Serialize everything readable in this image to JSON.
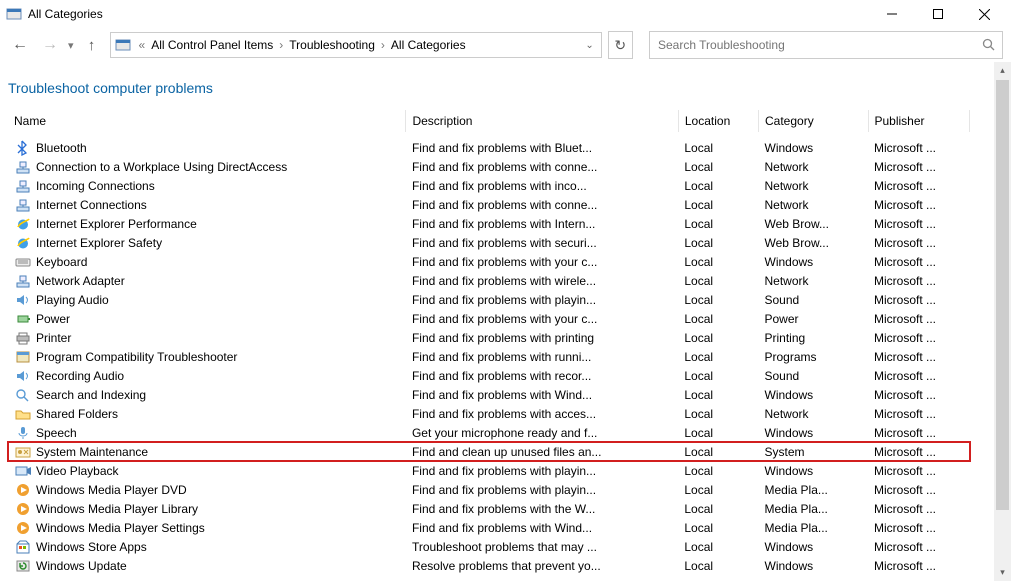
{
  "window": {
    "title": "All Categories"
  },
  "breadcrumb": {
    "icon_name": "control-panel-icon",
    "items": [
      "All Control Panel Items",
      "Troubleshooting",
      "All Categories"
    ]
  },
  "search": {
    "placeholder": "Search Troubleshooting"
  },
  "page": {
    "heading": "Troubleshoot computer problems"
  },
  "columns": {
    "name": "Name",
    "description": "Description",
    "location": "Location",
    "category": "Category",
    "publisher": "Publisher"
  },
  "rows": [
    {
      "icon": "bluetooth-icon",
      "name": "Bluetooth",
      "description": "Find and fix problems with Bluet...",
      "location": "Local",
      "category": "Windows",
      "publisher": "Microsoft ..."
    },
    {
      "icon": "network-icon",
      "name": "Connection to a Workplace Using DirectAccess",
      "description": "Find and fix problems with conne...",
      "location": "Local",
      "category": "Network",
      "publisher": "Microsoft ..."
    },
    {
      "icon": "network-icon",
      "name": "Incoming Connections",
      "description": "Find and fix problems with inco...",
      "location": "Local",
      "category": "Network",
      "publisher": "Microsoft ..."
    },
    {
      "icon": "network-icon",
      "name": "Internet Connections",
      "description": "Find and fix problems with conne...",
      "location": "Local",
      "category": "Network",
      "publisher": "Microsoft ..."
    },
    {
      "icon": "ie-icon",
      "name": "Internet Explorer Performance",
      "description": "Find and fix problems with Intern...",
      "location": "Local",
      "category": "Web Brow...",
      "publisher": "Microsoft ..."
    },
    {
      "icon": "ie-icon",
      "name": "Internet Explorer Safety",
      "description": "Find and fix problems with securi...",
      "location": "Local",
      "category": "Web Brow...",
      "publisher": "Microsoft ..."
    },
    {
      "icon": "keyboard-icon",
      "name": "Keyboard",
      "description": "Find and fix problems with your c...",
      "location": "Local",
      "category": "Windows",
      "publisher": "Microsoft ..."
    },
    {
      "icon": "network-icon",
      "name": "Network Adapter",
      "description": "Find and fix problems with wirele...",
      "location": "Local",
      "category": "Network",
      "publisher": "Microsoft ..."
    },
    {
      "icon": "sound-icon",
      "name": "Playing Audio",
      "description": "Find and fix problems with playin...",
      "location": "Local",
      "category": "Sound",
      "publisher": "Microsoft ..."
    },
    {
      "icon": "power-icon",
      "name": "Power",
      "description": "Find and fix problems with your c...",
      "location": "Local",
      "category": "Power",
      "publisher": "Microsoft ..."
    },
    {
      "icon": "printer-icon",
      "name": "Printer",
      "description": "Find and fix problems with printing",
      "location": "Local",
      "category": "Printing",
      "publisher": "Microsoft ..."
    },
    {
      "icon": "program-icon",
      "name": "Program Compatibility Troubleshooter",
      "description": "Find and fix problems with runni...",
      "location": "Local",
      "category": "Programs",
      "publisher": "Microsoft ..."
    },
    {
      "icon": "sound-icon",
      "name": "Recording Audio",
      "description": "Find and fix problems with recor...",
      "location": "Local",
      "category": "Sound",
      "publisher": "Microsoft ..."
    },
    {
      "icon": "search-icon",
      "name": "Search and Indexing",
      "description": "Find and fix problems with Wind...",
      "location": "Local",
      "category": "Windows",
      "publisher": "Microsoft ..."
    },
    {
      "icon": "folder-icon",
      "name": "Shared Folders",
      "description": "Find and fix problems with acces...",
      "location": "Local",
      "category": "Network",
      "publisher": "Microsoft ..."
    },
    {
      "icon": "mic-icon",
      "name": "Speech",
      "description": "Get your microphone ready and f...",
      "location": "Local",
      "category": "Windows",
      "publisher": "Microsoft ..."
    },
    {
      "icon": "maint-icon",
      "name": "System Maintenance",
      "description": "Find and clean up unused files an...",
      "location": "Local",
      "category": "System",
      "publisher": "Microsoft ...",
      "highlight": true
    },
    {
      "icon": "video-icon",
      "name": "Video Playback",
      "description": "Find and fix problems with playin...",
      "location": "Local",
      "category": "Windows",
      "publisher": "Microsoft ..."
    },
    {
      "icon": "wmp-icon",
      "name": "Windows Media Player DVD",
      "description": "Find and fix problems with playin...",
      "location": "Local",
      "category": "Media Pla...",
      "publisher": "Microsoft ..."
    },
    {
      "icon": "wmp-icon",
      "name": "Windows Media Player Library",
      "description": "Find and fix problems with the W...",
      "location": "Local",
      "category": "Media Pla...",
      "publisher": "Microsoft ..."
    },
    {
      "icon": "wmp-icon",
      "name": "Windows Media Player Settings",
      "description": "Find and fix problems with Wind...",
      "location": "Local",
      "category": "Media Pla...",
      "publisher": "Microsoft ..."
    },
    {
      "icon": "store-icon",
      "name": "Windows Store Apps",
      "description": "Troubleshoot problems that may ...",
      "location": "Local",
      "category": "Windows",
      "publisher": "Microsoft ..."
    },
    {
      "icon": "update-icon",
      "name": "Windows Update",
      "description": "Resolve problems that prevent yo...",
      "location": "Local",
      "category": "Windows",
      "publisher": "Microsoft ..."
    }
  ]
}
